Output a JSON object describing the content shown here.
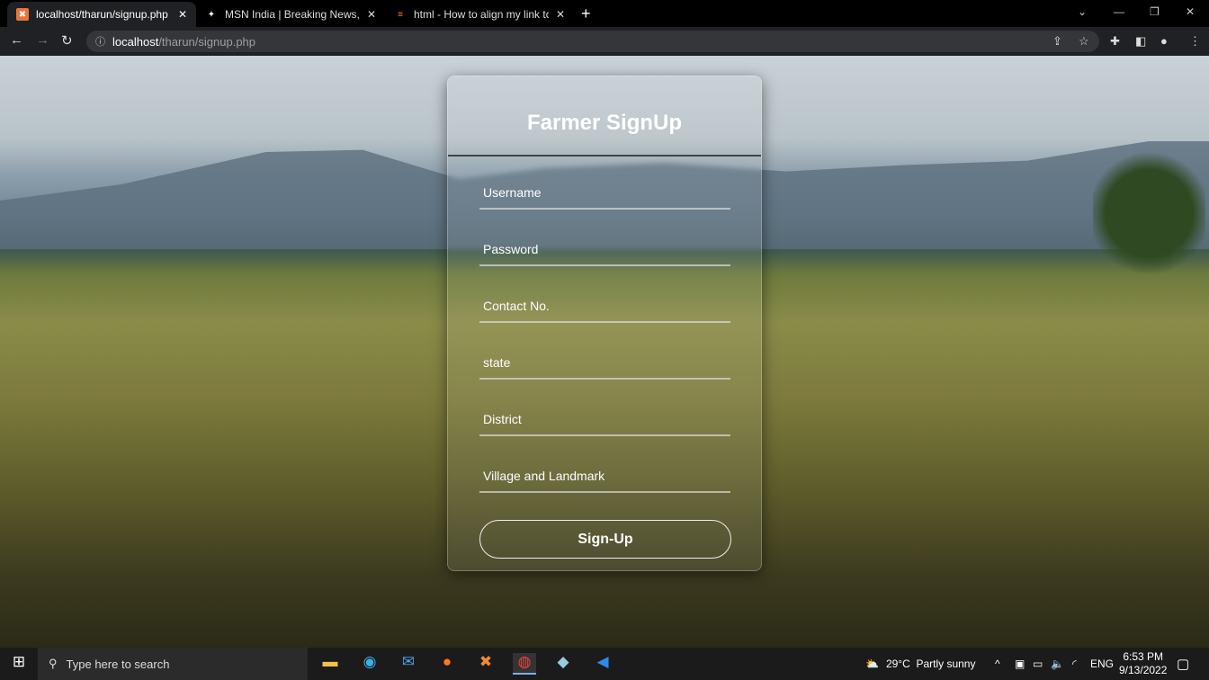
{
  "browser": {
    "tabs": [
      {
        "title": "localhost/tharun/signup.php",
        "icon": "xampp-icon",
        "active": true
      },
      {
        "title": "MSN India | Breaking News, Ente",
        "icon": "msn-icon",
        "active": false
      },
      {
        "title": "html - How to align my link to th",
        "icon": "stackoverflow-icon",
        "active": false
      }
    ],
    "url_host": "localhost",
    "url_path": "/tharun/signup.php"
  },
  "form": {
    "title": "Farmer SignUp",
    "fields": [
      "Username",
      "Password",
      "Contact No.",
      "state",
      "District",
      "Village and Landmark"
    ],
    "submit": "Sign-Up"
  },
  "taskbar": {
    "search_placeholder": "Type here to search",
    "weather": "29°C",
    "weather_desc": "Partly sunny",
    "lang": "ENG",
    "time": "6:53 PM",
    "date": "9/13/2022"
  }
}
